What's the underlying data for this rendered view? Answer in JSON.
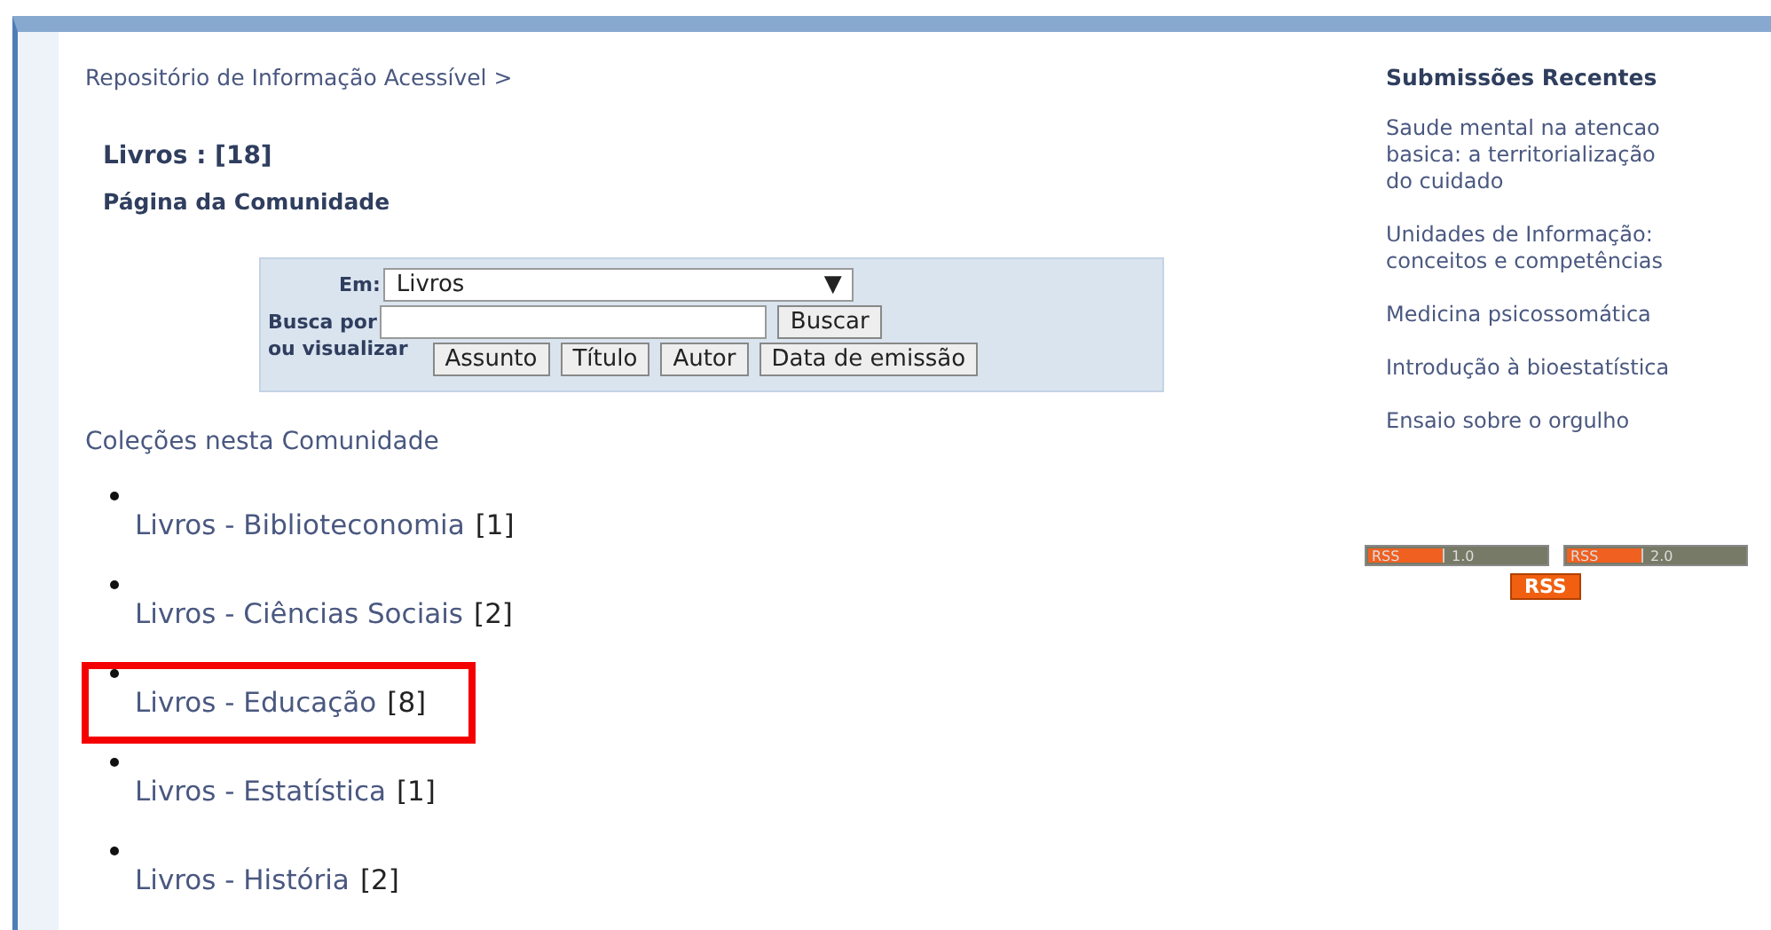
{
  "breadcrumb": "Repositório de Informação Acessível >",
  "title": "Livros : [18]",
  "subtitle": "Página da Comunidade",
  "search": {
    "scope_label": "Em:",
    "scope_value": "Livros",
    "scope_arrow": "▼",
    "query_label": "Busca por",
    "search_button": "Buscar",
    "browse_label": "ou visualizar",
    "browse_buttons": [
      "Assunto",
      "Título",
      "Autor",
      "Data de emissão"
    ]
  },
  "collections": {
    "heading": "Coleções nesta Comunidade",
    "items": [
      {
        "name": "Livros - Biblioteconomia",
        "count": "[1]",
        "highlighted": false
      },
      {
        "name": "Livros - Ciências Sociais",
        "count": "[2]",
        "highlighted": false
      },
      {
        "name": "Livros - Educação",
        "count": "[8]",
        "highlighted": true
      },
      {
        "name": "Livros - Estatística",
        "count": "[1]",
        "highlighted": false
      },
      {
        "name": "Livros - História",
        "count": "[2]",
        "highlighted": false
      }
    ]
  },
  "recent": {
    "heading": "Submissões Recentes",
    "items": [
      "Saude mental na atencao basica: a territorialização do cuidado",
      "Unidades de Informação: conceitos e competências",
      "Medicina psicossomática",
      "Introdução à bioestatística",
      "Ensaio sobre o orgulho"
    ]
  },
  "feeds": [
    {
      "label": "RSS",
      "version": "1.0"
    },
    {
      "label": "RSS",
      "version": "2.0"
    }
  ],
  "rss_badge": "RSS"
}
